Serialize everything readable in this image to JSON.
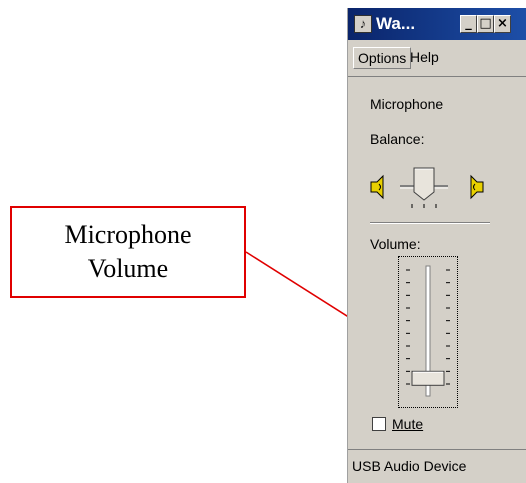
{
  "annotation": {
    "line1": "Microphone",
    "line2": "Volume",
    "border_color": "#e00000",
    "arrow_color": "#e00000"
  },
  "window": {
    "title": "Wa...",
    "title_icon": "volume-control-app-icon",
    "buttons": {
      "minimize": "_",
      "maximize": "□",
      "close": "×"
    }
  },
  "menu": {
    "options": "Options",
    "help": "Help"
  },
  "channel": {
    "name": "Microphone",
    "balance_label": "Balance:",
    "balance_left_icon": "speaker-left-icon",
    "balance_right_icon": "speaker-right-icon",
    "balance_value": 0.5,
    "volume_label": "Volume:",
    "volume_value": 0.05,
    "mute_label": "Mute",
    "mute_checked": false
  },
  "status": {
    "device": "USB Audio Device"
  }
}
